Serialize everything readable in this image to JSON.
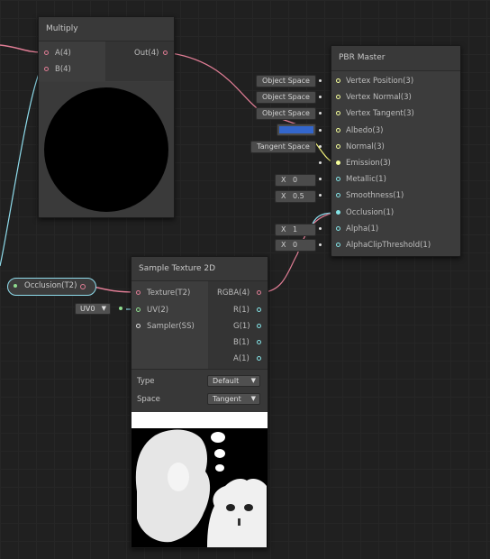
{
  "colors": {
    "texture_port": "#e07d95",
    "vector_port": "#8fdcec",
    "float_port": "#84e4e7",
    "vec3_port": "#f6ff9a",
    "albedo_swatch": "#3366cc"
  },
  "multiply": {
    "title": "Multiply",
    "inputs": [
      "A(4)",
      "B(4)"
    ],
    "output": "Out(4)"
  },
  "pbr": {
    "title": "PBR Master",
    "ports": [
      "Vertex Position(3)",
      "Vertex Normal(3)",
      "Vertex Tangent(3)",
      "Albedo(3)",
      "Normal(3)",
      "Emission(3)",
      "Metallic(1)",
      "Smoothness(1)",
      "Occlusion(1)",
      "Alpha(1)",
      "AlphaClipThreshold(1)"
    ],
    "space_fields": [
      "Object Space",
      "Object Space",
      "Object Space",
      "Tangent Space"
    ],
    "value_fields": [
      {
        "label": "X",
        "value": "0"
      },
      {
        "label": "X",
        "value": "0.5"
      },
      {
        "label": "X",
        "value": "1"
      },
      {
        "label": "X",
        "value": "0"
      }
    ]
  },
  "property": {
    "label": "Occlusion(T2)"
  },
  "sample": {
    "title": "Sample Texture 2D",
    "inputs": [
      "Texture(T2)",
      "UV(2)",
      "Sampler(SS)"
    ],
    "outputs": [
      "RGBA(4)",
      "R(1)",
      "G(1)",
      "B(1)",
      "A(1)"
    ],
    "uv_field": "UV0",
    "type_label": "Type",
    "type_value": "Default",
    "space_label": "Space",
    "space_value": "Tangent"
  }
}
